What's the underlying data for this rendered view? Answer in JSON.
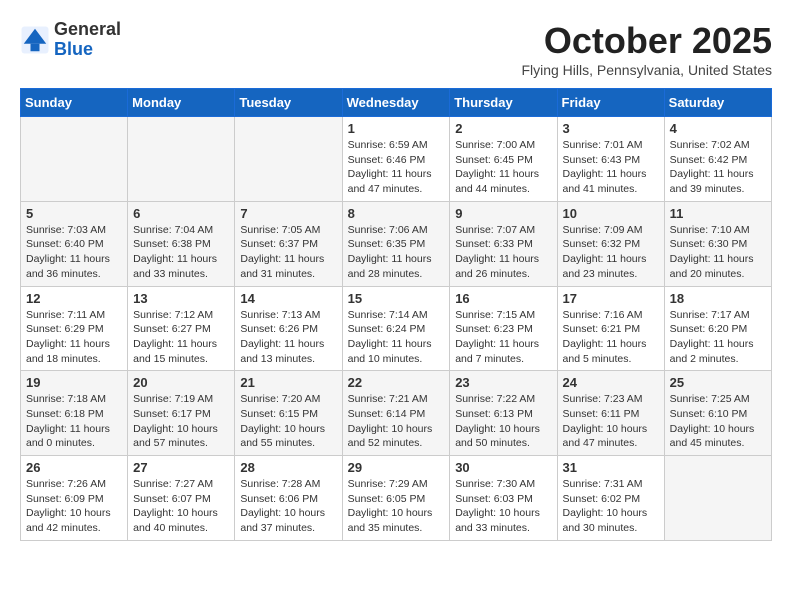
{
  "header": {
    "logo_general": "General",
    "logo_blue": "Blue",
    "month_title": "October 2025",
    "location": "Flying Hills, Pennsylvania, United States"
  },
  "weekdays": [
    "Sunday",
    "Monday",
    "Tuesday",
    "Wednesday",
    "Thursday",
    "Friday",
    "Saturday"
  ],
  "weeks": [
    [
      {
        "day": "",
        "info": ""
      },
      {
        "day": "",
        "info": ""
      },
      {
        "day": "",
        "info": ""
      },
      {
        "day": "1",
        "info": "Sunrise: 6:59 AM\nSunset: 6:46 PM\nDaylight: 11 hours\nand 47 minutes."
      },
      {
        "day": "2",
        "info": "Sunrise: 7:00 AM\nSunset: 6:45 PM\nDaylight: 11 hours\nand 44 minutes."
      },
      {
        "day": "3",
        "info": "Sunrise: 7:01 AM\nSunset: 6:43 PM\nDaylight: 11 hours\nand 41 minutes."
      },
      {
        "day": "4",
        "info": "Sunrise: 7:02 AM\nSunset: 6:42 PM\nDaylight: 11 hours\nand 39 minutes."
      }
    ],
    [
      {
        "day": "5",
        "info": "Sunrise: 7:03 AM\nSunset: 6:40 PM\nDaylight: 11 hours\nand 36 minutes."
      },
      {
        "day": "6",
        "info": "Sunrise: 7:04 AM\nSunset: 6:38 PM\nDaylight: 11 hours\nand 33 minutes."
      },
      {
        "day": "7",
        "info": "Sunrise: 7:05 AM\nSunset: 6:37 PM\nDaylight: 11 hours\nand 31 minutes."
      },
      {
        "day": "8",
        "info": "Sunrise: 7:06 AM\nSunset: 6:35 PM\nDaylight: 11 hours\nand 28 minutes."
      },
      {
        "day": "9",
        "info": "Sunrise: 7:07 AM\nSunset: 6:33 PM\nDaylight: 11 hours\nand 26 minutes."
      },
      {
        "day": "10",
        "info": "Sunrise: 7:09 AM\nSunset: 6:32 PM\nDaylight: 11 hours\nand 23 minutes."
      },
      {
        "day": "11",
        "info": "Sunrise: 7:10 AM\nSunset: 6:30 PM\nDaylight: 11 hours\nand 20 minutes."
      }
    ],
    [
      {
        "day": "12",
        "info": "Sunrise: 7:11 AM\nSunset: 6:29 PM\nDaylight: 11 hours\nand 18 minutes."
      },
      {
        "day": "13",
        "info": "Sunrise: 7:12 AM\nSunset: 6:27 PM\nDaylight: 11 hours\nand 15 minutes."
      },
      {
        "day": "14",
        "info": "Sunrise: 7:13 AM\nSunset: 6:26 PM\nDaylight: 11 hours\nand 13 minutes."
      },
      {
        "day": "15",
        "info": "Sunrise: 7:14 AM\nSunset: 6:24 PM\nDaylight: 11 hours\nand 10 minutes."
      },
      {
        "day": "16",
        "info": "Sunrise: 7:15 AM\nSunset: 6:23 PM\nDaylight: 11 hours\nand 7 minutes."
      },
      {
        "day": "17",
        "info": "Sunrise: 7:16 AM\nSunset: 6:21 PM\nDaylight: 11 hours\nand 5 minutes."
      },
      {
        "day": "18",
        "info": "Sunrise: 7:17 AM\nSunset: 6:20 PM\nDaylight: 11 hours\nand 2 minutes."
      }
    ],
    [
      {
        "day": "19",
        "info": "Sunrise: 7:18 AM\nSunset: 6:18 PM\nDaylight: 11 hours\nand 0 minutes."
      },
      {
        "day": "20",
        "info": "Sunrise: 7:19 AM\nSunset: 6:17 PM\nDaylight: 10 hours\nand 57 minutes."
      },
      {
        "day": "21",
        "info": "Sunrise: 7:20 AM\nSunset: 6:15 PM\nDaylight: 10 hours\nand 55 minutes."
      },
      {
        "day": "22",
        "info": "Sunrise: 7:21 AM\nSunset: 6:14 PM\nDaylight: 10 hours\nand 52 minutes."
      },
      {
        "day": "23",
        "info": "Sunrise: 7:22 AM\nSunset: 6:13 PM\nDaylight: 10 hours\nand 50 minutes."
      },
      {
        "day": "24",
        "info": "Sunrise: 7:23 AM\nSunset: 6:11 PM\nDaylight: 10 hours\nand 47 minutes."
      },
      {
        "day": "25",
        "info": "Sunrise: 7:25 AM\nSunset: 6:10 PM\nDaylight: 10 hours\nand 45 minutes."
      }
    ],
    [
      {
        "day": "26",
        "info": "Sunrise: 7:26 AM\nSunset: 6:09 PM\nDaylight: 10 hours\nand 42 minutes."
      },
      {
        "day": "27",
        "info": "Sunrise: 7:27 AM\nSunset: 6:07 PM\nDaylight: 10 hours\nand 40 minutes."
      },
      {
        "day": "28",
        "info": "Sunrise: 7:28 AM\nSunset: 6:06 PM\nDaylight: 10 hours\nand 37 minutes."
      },
      {
        "day": "29",
        "info": "Sunrise: 7:29 AM\nSunset: 6:05 PM\nDaylight: 10 hours\nand 35 minutes."
      },
      {
        "day": "30",
        "info": "Sunrise: 7:30 AM\nSunset: 6:03 PM\nDaylight: 10 hours\nand 33 minutes."
      },
      {
        "day": "31",
        "info": "Sunrise: 7:31 AM\nSunset: 6:02 PM\nDaylight: 10 hours\nand 30 minutes."
      },
      {
        "day": "",
        "info": ""
      }
    ]
  ]
}
